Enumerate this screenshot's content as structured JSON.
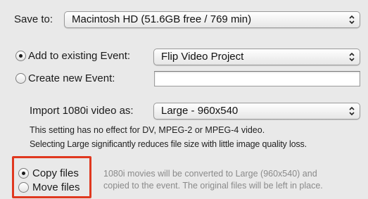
{
  "save_to": {
    "label": "Save to:",
    "value": "Macintosh HD (51.6GB free / 769 min)"
  },
  "event_choice": {
    "existing_label": "Add to existing Event:",
    "existing_selected": true,
    "existing_value": "Flip Video Project",
    "new_label": "Create new Event:",
    "new_selected": false,
    "new_value": ""
  },
  "import_1080i": {
    "label": "Import 1080i video as:",
    "value": "Large - 960x540",
    "note_line1": "This setting has no effect for DV, MPEG-2 or MPEG-4 video.",
    "note_line2": "Selecting Large significantly reduces file size with little image quality loss."
  },
  "file_handling": {
    "copy_label": "Copy files",
    "copy_selected": true,
    "move_label": "Move files",
    "move_selected": false,
    "description_line1": "1080i movies will be converted to Large (960x540) and",
    "description_line2": "copied to the event. The original files will be left in place."
  },
  "icons": {
    "popup_arrows": "up-down-chevron-icon",
    "radio": "radio-button-icon"
  },
  "colors": {
    "highlight": "#e0381f",
    "background": "#e9e9e9"
  }
}
